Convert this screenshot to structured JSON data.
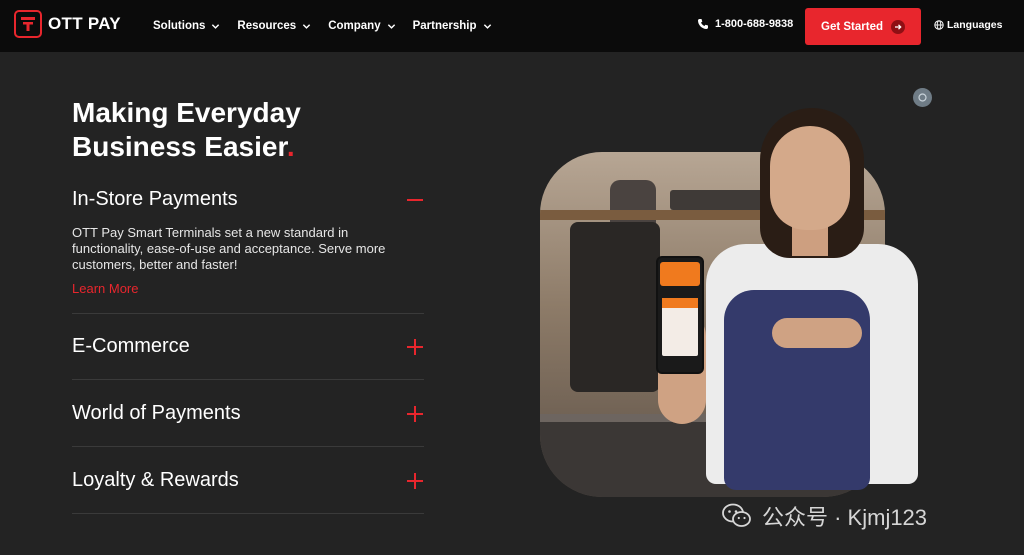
{
  "brand": {
    "name": "OTT PAY"
  },
  "nav": {
    "items": [
      {
        "label": "Solutions"
      },
      {
        "label": "Resources"
      },
      {
        "label": "Company"
      },
      {
        "label": "Partnership"
      }
    ],
    "phone": "1-800-688-9838",
    "cta_label": "Get Started",
    "languages_label": "Languages"
  },
  "hero": {
    "title_line1": "Making Everyday",
    "title_line2": "Business Easier",
    "title_dot": "."
  },
  "accordion": [
    {
      "title": "In-Store Payments",
      "expanded": true,
      "description": "OTT Pay Smart Terminals set a new standard in functionality, ease-of-use and acceptance. Serve more customers, better and faster!",
      "link_label": "Learn More"
    },
    {
      "title": "E-Commerce",
      "expanded": false
    },
    {
      "title": "World of Payments",
      "expanded": false
    },
    {
      "title": "Loyalty & Rewards",
      "expanded": false
    }
  ],
  "watermark": {
    "text": "公众号 · Kjmj123"
  },
  "colors": {
    "accent": "#e8262d",
    "background": "#232323",
    "nav_background": "#0b0b0b"
  },
  "icons": {
    "logo": "ott-pay-logo-icon",
    "chevron": "chevron-down-icon",
    "phone": "phone-icon",
    "arrow": "arrow-right-icon",
    "globe": "globe-icon",
    "minus": "minus-icon",
    "plus": "plus-icon",
    "wechat": "wechat-icon"
  }
}
